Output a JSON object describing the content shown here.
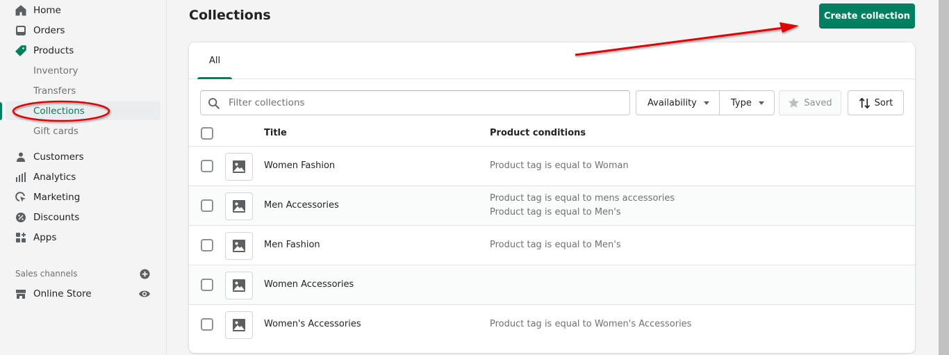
{
  "sidebar": {
    "items": [
      {
        "label": "Home",
        "icon": "home-icon"
      },
      {
        "label": "Orders",
        "icon": "orders-icon"
      },
      {
        "label": "Products",
        "icon": "tag-icon"
      },
      {
        "label": "Inventory"
      },
      {
        "label": "Transfers"
      },
      {
        "label": "Collections",
        "active": true
      },
      {
        "label": "Gift cards"
      },
      {
        "label": "Customers",
        "icon": "customer-icon"
      },
      {
        "label": "Analytics",
        "icon": "analytics-icon"
      },
      {
        "label": "Marketing",
        "icon": "marketing-icon"
      },
      {
        "label": "Discounts",
        "icon": "discount-icon"
      },
      {
        "label": "Apps",
        "icon": "apps-icon"
      }
    ],
    "sales_channels": {
      "label": "Sales channels",
      "items": [
        {
          "label": "Online Store",
          "icon": "store-icon"
        }
      ]
    }
  },
  "page": {
    "title": "Collections",
    "primary_action": "Create collection"
  },
  "tabs": [
    {
      "label": "All",
      "selected": true
    }
  ],
  "filters": {
    "search_placeholder": "Filter collections",
    "search_value": "",
    "availability": "Availability",
    "type": "Type",
    "saved": "Saved",
    "sort": "Sort"
  },
  "table": {
    "columns": [
      "Title",
      "Product conditions"
    ],
    "rows": [
      {
        "title": "Women Fashion",
        "conditions": [
          "Product tag is equal to Woman"
        ]
      },
      {
        "title": "Men Accessories",
        "conditions": [
          "Product tag is equal to mens accessories",
          "Product tag is equal to Men's"
        ]
      },
      {
        "title": "Men Fashion",
        "conditions": [
          "Product tag is equal to Men's"
        ]
      },
      {
        "title": "Women Accessories",
        "conditions": []
      },
      {
        "title": "Women's Accessories",
        "conditions": [
          "Product tag is equal to Women's Accessories"
        ]
      }
    ]
  },
  "colors": {
    "brand": "#008060",
    "annotation": "#e00000"
  }
}
